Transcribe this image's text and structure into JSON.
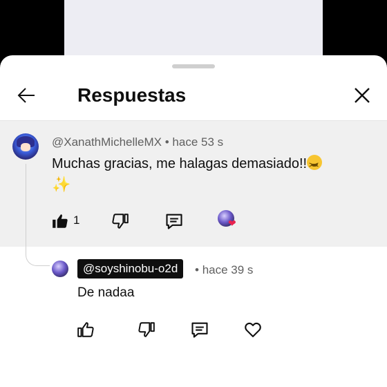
{
  "header": {
    "title": "Respuestas",
    "back_icon": "arrow-left-icon",
    "close_icon": "close-icon"
  },
  "comment": {
    "author": "@XanathMichelleMX",
    "time": "hace 53 s",
    "separator": "•",
    "text": "Muchas gracias, me halagas demasiado!!",
    "emoji_1": "😖",
    "emoji_2": "✨",
    "like_count": "1",
    "creator_heart_icon": "creator-heart-icon"
  },
  "reply": {
    "author": "@soyshinobu-o2d",
    "separator": "•",
    "time": "hace 39 s",
    "text": "De nadaa"
  },
  "colors": {
    "comment_background": "#f0f0f0",
    "heart": "#e8234f",
    "handle_chip": "#0f0f0f"
  }
}
